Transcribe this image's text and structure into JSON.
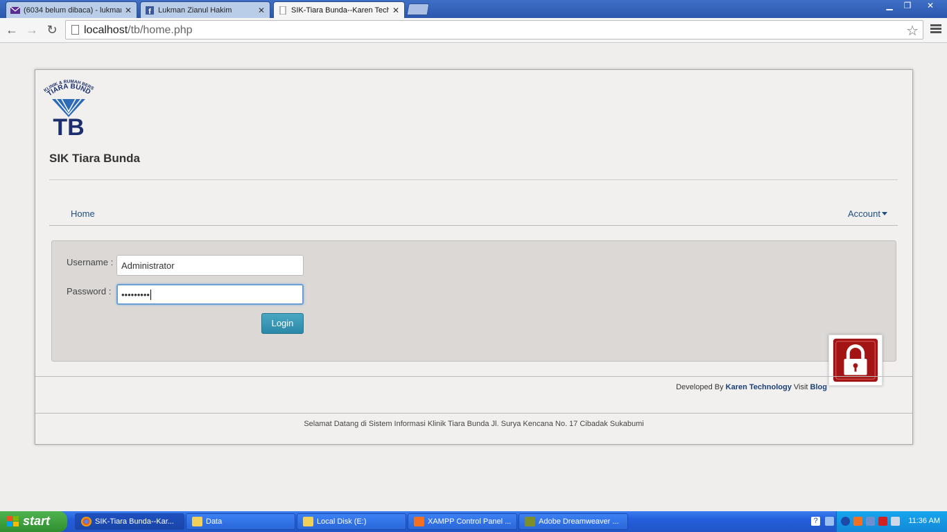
{
  "browser": {
    "tabs": [
      {
        "title": "(6034 belum dibaca) - lukmar"
      },
      {
        "title": "Lukman Zianul Hakim"
      },
      {
        "title": "SIK-Tiara Bunda--Karen Tech"
      }
    ],
    "url_host": "localhost",
    "url_path": "/tb/home.php"
  },
  "site": {
    "title": "SIK Tiara Bunda",
    "logo_text": "KLINIK & RUMAH BERSALIN TIARA BUNDA TB"
  },
  "nav": {
    "home": "Home",
    "account": "Account"
  },
  "login": {
    "username_label": "Username :",
    "username_value": "Administrator",
    "password_label": "Password :",
    "password_value": "•••••••••",
    "button": "Login"
  },
  "footer": {
    "credit_prefix": "Developed By",
    "company": "Karen Technology",
    "visit": "Visit",
    "blog": "Blog",
    "welcome": "Selamat Datang di Sistem Informasi Klinik Tiara Bunda Jl. Surya Kencana No. 17 Cibadak Sukabumi"
  },
  "taskbar": {
    "start": "start",
    "items": [
      {
        "label": "SIK-Tiara Bunda--Kar..."
      },
      {
        "label": "Data"
      },
      {
        "label": "Local Disk (E:)"
      },
      {
        "label": "XAMPP Control Panel ..."
      },
      {
        "label": "Adobe Dreamweaver ..."
      }
    ],
    "clock": "11:36 AM"
  }
}
